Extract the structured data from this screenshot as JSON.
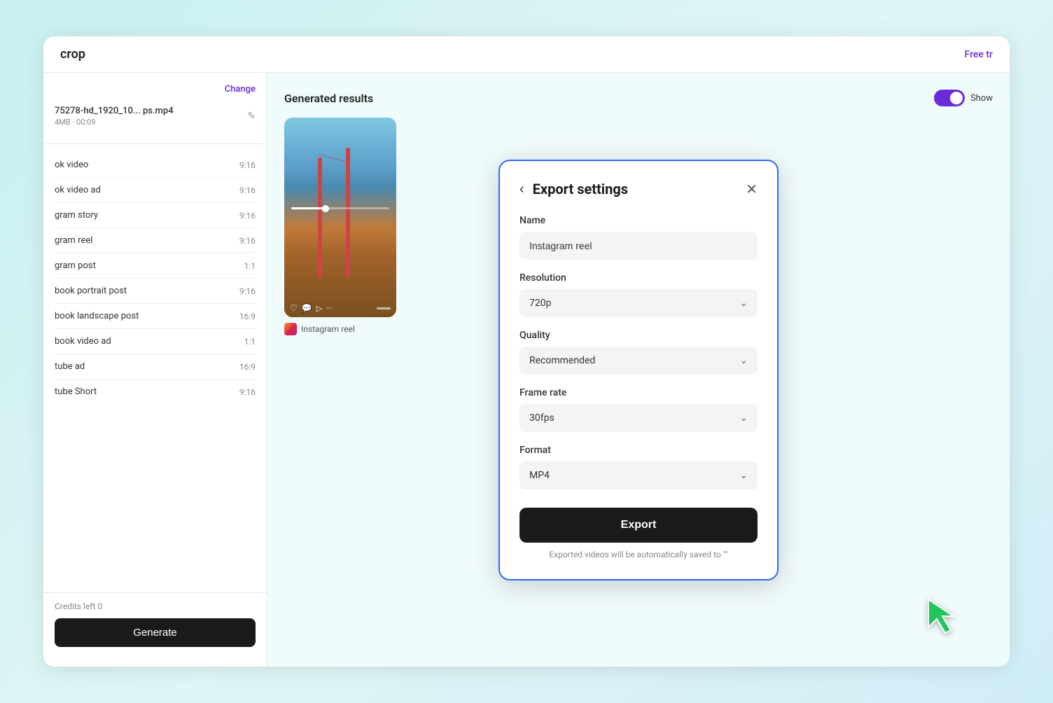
{
  "topbar": {
    "title": "crop",
    "free_trial": "Free tr"
  },
  "sidebar": {
    "change_label": "Change",
    "file": {
      "name": "75278-hd_1920_10... ps.mp4",
      "size": "4MB",
      "duration": "00:09"
    },
    "items": [
      {
        "name": "ok video",
        "ratio": "9:16"
      },
      {
        "name": "ok video ad",
        "ratio": "9:16"
      },
      {
        "name": "gram story",
        "ratio": "9:16"
      },
      {
        "name": "gram reel",
        "ratio": "9:16"
      },
      {
        "name": "gram post",
        "ratio": "1:1"
      },
      {
        "name": "book portrait post",
        "ratio": "9:16"
      },
      {
        "name": "book landscape post",
        "ratio": "16:9"
      },
      {
        "name": "book video ad",
        "ratio": "1:1"
      },
      {
        "name": "tube ad",
        "ratio": "16:9"
      },
      {
        "name": "tube Short",
        "ratio": "9:16"
      }
    ],
    "credits_label": "Credits left",
    "credits_value": "0",
    "generate_label": "Generate"
  },
  "right_panel": {
    "title": "Generated results",
    "show_label": "Show",
    "video_label": "Instagram reel"
  },
  "modal": {
    "title": "Export settings",
    "back_label": "‹",
    "close_label": "✕",
    "name_label": "Name",
    "name_value": "Instagram reel",
    "resolution_label": "Resolution",
    "resolution_value": "720p",
    "quality_label": "Quality",
    "quality_value": "Recommended",
    "framerate_label": "Frame rate",
    "framerate_value": "30fps",
    "format_label": "Format",
    "format_value": "MP4",
    "export_label": "Export",
    "export_note": "Exported videos will be automatically saved to \""
  }
}
